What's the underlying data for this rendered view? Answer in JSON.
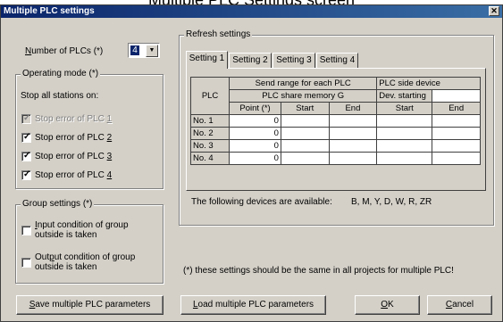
{
  "caption": "Multiple PLC Settings screen",
  "window": {
    "title": "Multiple PLC settings",
    "close_glyph": "✕"
  },
  "num_plcs": {
    "label_pre": "",
    "label_u": "N",
    "label_post": "umber of PLCs (*)",
    "value": "4"
  },
  "operating_mode": {
    "title": "Operating mode (*)",
    "subtitle": "Stop all stations on:",
    "items": [
      {
        "pre": "Stop error of PLC ",
        "u": "1",
        "checked": true,
        "disabled": true
      },
      {
        "pre": "Stop error of PLC ",
        "u": "2",
        "checked": true,
        "disabled": false
      },
      {
        "pre": "Stop error of PLC ",
        "u": "3",
        "checked": true,
        "disabled": false
      },
      {
        "pre": "Stop error of PLC ",
        "u": "4",
        "checked": true,
        "disabled": false
      }
    ]
  },
  "group_settings": {
    "title": "Group settings (*)",
    "input": {
      "u": "I",
      "line1": "nput condition of group",
      "line2": "outside is taken",
      "checked": false
    },
    "output": {
      "pre": "Out",
      "u": "p",
      "line1": "ut condition of group",
      "line2": "outside is taken",
      "checked": false
    }
  },
  "refresh": {
    "title": "Refresh settings",
    "tabs": [
      "Setting 1",
      "Setting 2",
      "Setting 3",
      "Setting 4"
    ],
    "active_tab": 0,
    "table": {
      "plc_header": "PLC",
      "send_range_header": "Send range for each PLC",
      "plc_side_header": "PLC side device",
      "share_memory": "PLC share memory G",
      "dev_starting": "Dev. starting",
      "col_point": "Point (*)",
      "col_start": "Start",
      "col_end": "End",
      "col_start2": "Start",
      "col_end2": "End",
      "rows": [
        {
          "name": "No. 1",
          "point": "0"
        },
        {
          "name": "No. 2",
          "point": "0"
        },
        {
          "name": "No. 3",
          "point": "0"
        },
        {
          "name": "No. 4",
          "point": "0"
        }
      ]
    },
    "devices_label": "The following devices are available:",
    "devices": "B, M, Y, D, W, R, ZR"
  },
  "note": "(*) these settings should be the same in all projects for multiple PLC!",
  "buttons": {
    "save": {
      "u": "S",
      "rest": "ave multiple PLC parameters"
    },
    "load": {
      "u": "L",
      "rest": "oad multiple PLC parameters"
    },
    "ok": {
      "u": "O",
      "rest": "K"
    },
    "cancel": {
      "u": "C",
      "rest": "ancel"
    }
  }
}
